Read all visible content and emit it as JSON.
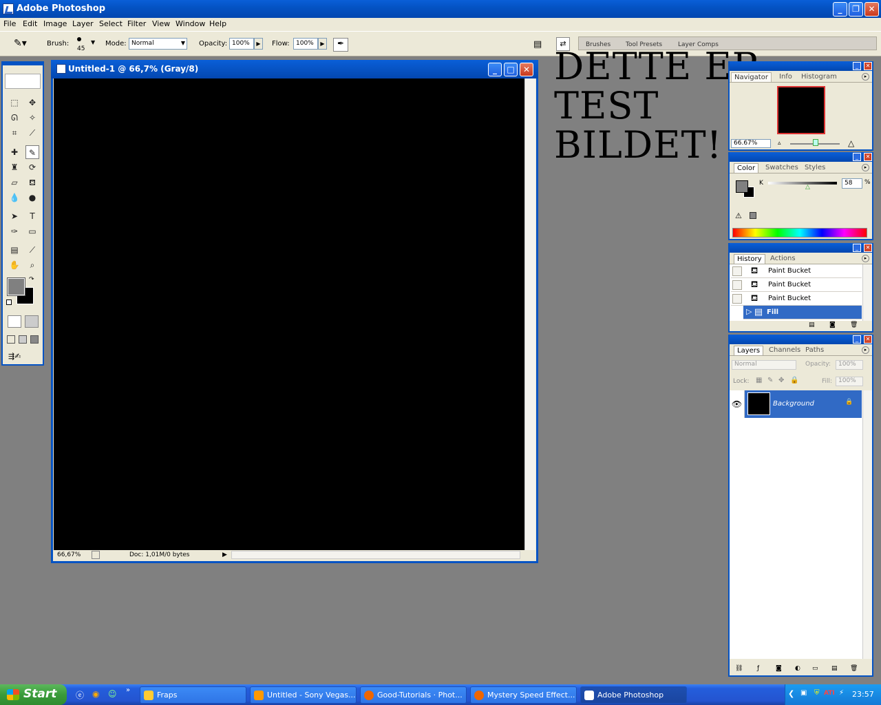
{
  "window": {
    "title": "Adobe Photoshop"
  },
  "menu": [
    "File",
    "Edit",
    "Image",
    "Layer",
    "Select",
    "Filter",
    "View",
    "Window",
    "Help"
  ],
  "options": {
    "brush_label": "Brush:",
    "brush_size": "45",
    "mode_label": "Mode:",
    "mode_value": "Normal",
    "opacity_label": "Opacity:",
    "opacity_value": "100%",
    "flow_label": "Flow:",
    "flow_value": "100%",
    "palette_well": [
      "Brushes",
      "Tool Presets",
      "Layer Comps"
    ]
  },
  "document": {
    "title": "Untitled-1 @ 66,7% (Gray/8)",
    "zoom": "66,67%",
    "doc_info": "Doc: 1,01M/0 bytes",
    "canvas_color": "#000000"
  },
  "overlay_text": "DETTE ER\nTEST\nBILDET!",
  "navigator": {
    "tabs": [
      "Navigator",
      "Info",
      "Histogram"
    ],
    "zoom": "66.67%"
  },
  "color_panel": {
    "tabs": [
      "Color",
      "Swatches",
      "Styles"
    ],
    "channel": "K",
    "value": "58",
    "unit": "%"
  },
  "history": {
    "tabs": [
      "History",
      "Actions"
    ],
    "items": [
      {
        "label": "Paint Bucket",
        "icon": "paint-bucket-icon"
      },
      {
        "label": "Paint Bucket",
        "icon": "paint-bucket-icon"
      },
      {
        "label": "Paint Bucket",
        "icon": "paint-bucket-icon"
      },
      {
        "label": "Fill",
        "icon": "fill-icon"
      }
    ]
  },
  "layers": {
    "tabs": [
      "Layers",
      "Channels",
      "Paths"
    ],
    "blend": "Normal",
    "opacity_label": "Opacity:",
    "opacity": "100%",
    "lock_label": "Lock:",
    "fill_label": "Fill:",
    "fill": "100%",
    "layer_name": "Background"
  },
  "taskbar": {
    "start": "Start",
    "items": [
      "Fraps",
      "Untitled - Sony Vegas...",
      "Good-Tutorials · Phot...",
      "Mystery Speed Effect...",
      "Adobe Photoshop"
    ],
    "clock": "23:57"
  },
  "colors": {
    "accent": "#0453c4",
    "selection": "#316ac5",
    "foreground": "#808080",
    "background": "#000000"
  }
}
